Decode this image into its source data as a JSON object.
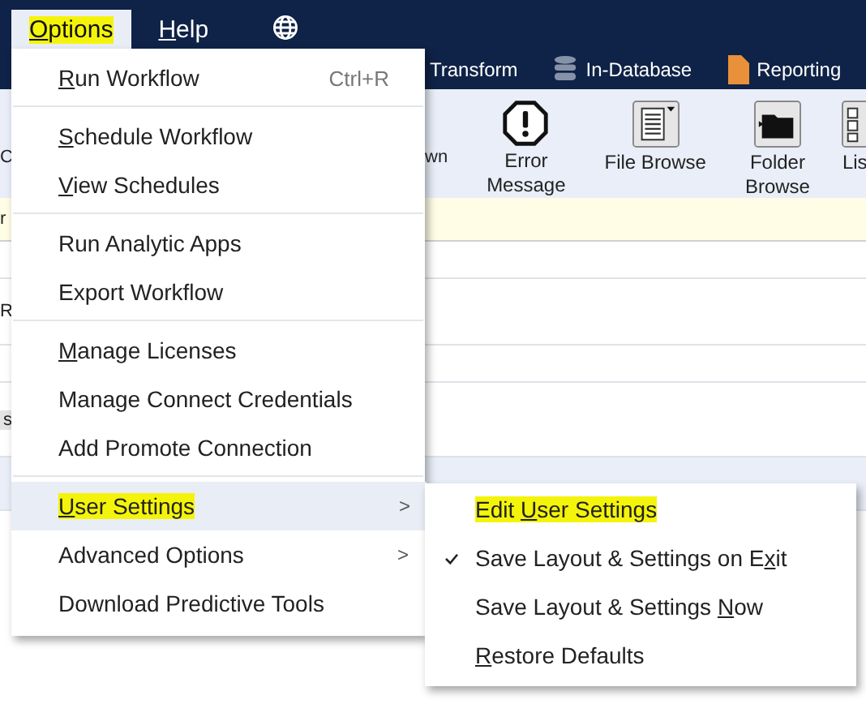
{
  "menu_bar": [
    {
      "key": "O",
      "post": "ptions",
      "selected": true,
      "highlighted": true
    },
    {
      "key": "H",
      "post": "elp",
      "selected": false,
      "highlighted": false
    }
  ],
  "ribbon_tabs": [
    {
      "label": "Transform",
      "kind": "plain"
    },
    {
      "label": "In-Database",
      "kind": "database"
    },
    {
      "label": "Reporting",
      "kind": "report"
    }
  ],
  "toolbar": {
    "left_fragment": "C",
    "cut_label": "wn",
    "tools": [
      {
        "label": "Error Message",
        "kind": "error"
      },
      {
        "label": "File Browse",
        "kind": "file"
      },
      {
        "label": "Folder Browse",
        "kind": "folder"
      },
      {
        "label": "Lis",
        "kind": "list"
      }
    ]
  },
  "notice_fragment": "r",
  "canvas_fragments": [
    "R",
    "s"
  ],
  "options_menu": {
    "groups": [
      [
        {
          "key": "R",
          "post": "un Workflow",
          "shortcut": "Ctrl+R",
          "selected": false,
          "highlighted": false
        }
      ],
      [
        {
          "key": "S",
          "post": "chedule Workflow",
          "selected": false,
          "highlighted": false
        },
        {
          "key": "V",
          "post": "iew Schedules",
          "selected": false,
          "highlighted": false
        }
      ],
      [
        {
          "pre": "Run Analytic Apps",
          "selected": false,
          "highlighted": false
        },
        {
          "pre": "Export Workflow",
          "selected": false,
          "highlighted": false
        }
      ],
      [
        {
          "key": "M",
          "post": "anage Licenses",
          "selected": false,
          "highlighted": false
        },
        {
          "pre": "Manage Connect Credentials",
          "selected": false,
          "highlighted": false
        },
        {
          "pre": "Add Promote Connection",
          "selected": false,
          "highlighted": false
        }
      ],
      [
        {
          "key": "U",
          "post": "ser Settings",
          "arrow": ">",
          "selected": true,
          "highlighted": true
        },
        {
          "pre": "Advanced Options",
          "arrow": ">",
          "selected": false,
          "highlighted": false
        },
        {
          "pre": "Download Predictive Tools",
          "selected": false,
          "highlighted": false
        }
      ]
    ]
  },
  "user_settings_submenu": [
    {
      "pre": "Edit ",
      "key": "U",
      "post": "ser Settings",
      "checked": false,
      "highlighted": true
    },
    {
      "pre": "Save Layout & Settings on E",
      "key": "x",
      "post": "it",
      "checked": true,
      "highlighted": false
    },
    {
      "pre": "Save Layout & Settings ",
      "key": "N",
      "post": "ow",
      "checked": false,
      "highlighted": false
    },
    {
      "key": "R",
      "post": "estore Defaults",
      "checked": false,
      "highlighted": false
    }
  ]
}
